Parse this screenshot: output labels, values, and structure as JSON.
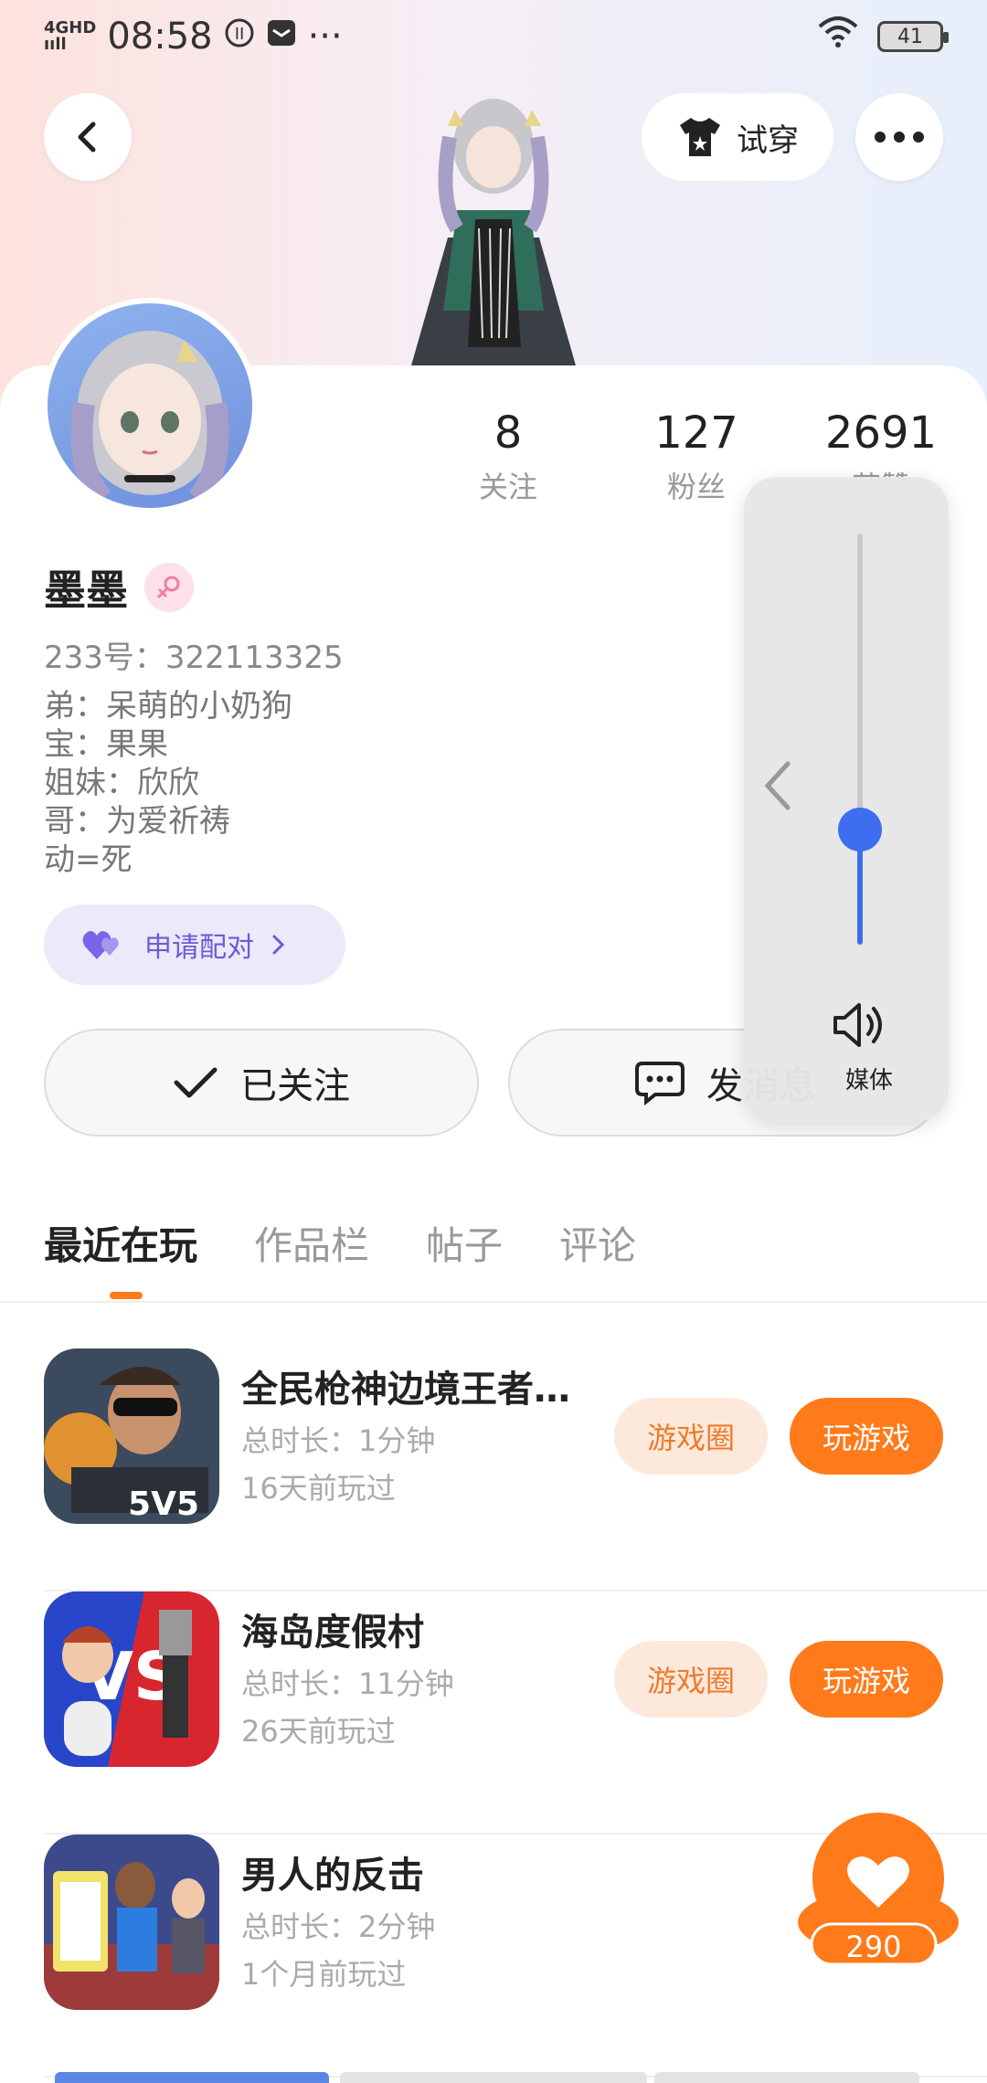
{
  "status_bar": {
    "net_top": "4GHD",
    "net_bottom": "ııll",
    "time": "08:58",
    "more": "···",
    "battery": "41"
  },
  "header": {
    "tryon_label": "试穿"
  },
  "stats": [
    {
      "num": "8",
      "label": "关注"
    },
    {
      "num": "127",
      "label": "粉丝"
    },
    {
      "num": "2691",
      "label": "获赞"
    }
  ],
  "profile": {
    "name": "墨墨",
    "uid": "233号：322113325",
    "bio": [
      "弟：呆萌的小奶狗",
      "宝：果果",
      "姐妹：欣欣",
      "哥：为爱祈祷",
      "动=死"
    ],
    "pair_label": "申请配对"
  },
  "actions": {
    "follow_label": "已关注",
    "message_label": "发消息"
  },
  "tabs": [
    "最近在玩",
    "作品栏",
    "帖子",
    "评论"
  ],
  "games": [
    {
      "title": "全民枪神边境王者…",
      "duration": "总时长：1分钟",
      "last_played": "16天前玩过",
      "circle_label": "游戏圈",
      "play_label": "玩游戏"
    },
    {
      "title": "海岛度假村",
      "duration": "总时长：11分钟",
      "last_played": "26天前玩过",
      "circle_label": "游戏圈",
      "play_label": "玩游戏"
    },
    {
      "title": "男人的反击",
      "duration": "总时长：2分钟",
      "last_played": "1个月前玩过"
    }
  ],
  "volume": {
    "label": "媒体",
    "level": 0.28
  },
  "like_fab": {
    "count": "290"
  },
  "colors": {
    "accent_orange": "#ff7a1a",
    "accent_blue": "#3f6df0",
    "pair_purple": "#6a5bd6"
  }
}
